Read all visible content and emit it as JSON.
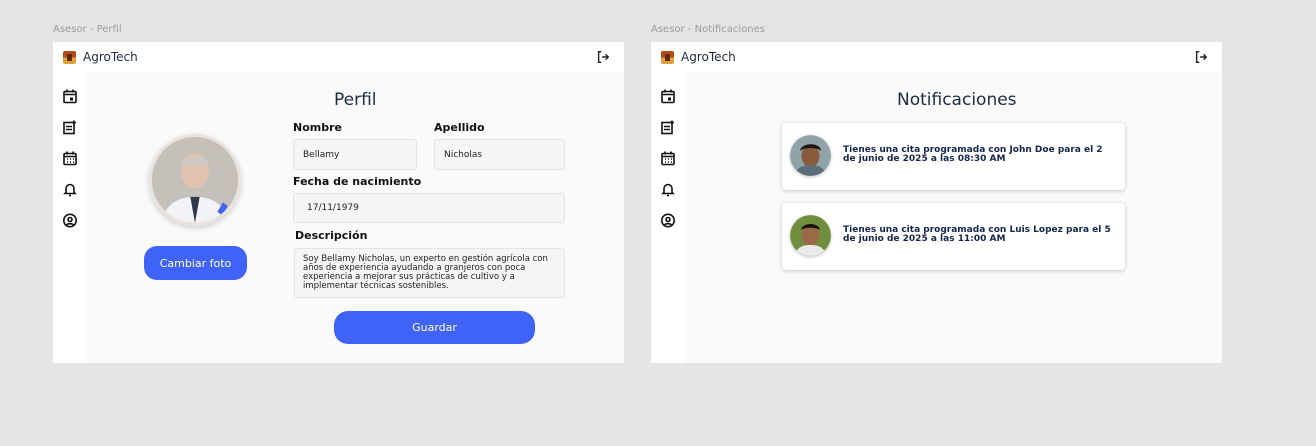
{
  "frames": [
    {
      "label": "Asesor - Perfil"
    },
    {
      "label": "Asesor - Notificaciones"
    }
  ],
  "app": {
    "name": "AgroTech"
  },
  "sidebar_icons": [
    "calendar-icon",
    "note-add-icon",
    "calendar-grid-icon",
    "bell-icon",
    "user-circle-icon"
  ],
  "profile": {
    "title": "Perfil",
    "change_photo_label": "Cambiar foto",
    "first_name_label": "Nombre",
    "first_name_value": "Bellamy",
    "last_name_label": "Apellido",
    "last_name_value": "Nicholas",
    "birthdate_label": "Fecha de nacimiento",
    "birthdate_value": "17/11/1979",
    "description_label": "Descripción",
    "description_value": "Soy Bellamy Nicholas, un experto en gestión agrícola con años de experiencia ayudando a granjeros con poca experiencia a mejorar sus prácticas de cultivo y a implementar técnicas sostenibles.",
    "save_label": "Guardar"
  },
  "notifications": {
    "title": "Notificaciones",
    "items": [
      {
        "text": "Tienes una cita programada con John Doe para el 2 de junio de 2025 a las 08:30 AM"
      },
      {
        "text": "Tienes una cita programada con Luis Lopez para el 5 de junio de 2025 a las 11:00 AM"
      }
    ]
  },
  "colors": {
    "accent": "#3f63f6",
    "background": "#e5e5e5",
    "panel": "#fafafa",
    "notif_text": "#13254a"
  }
}
